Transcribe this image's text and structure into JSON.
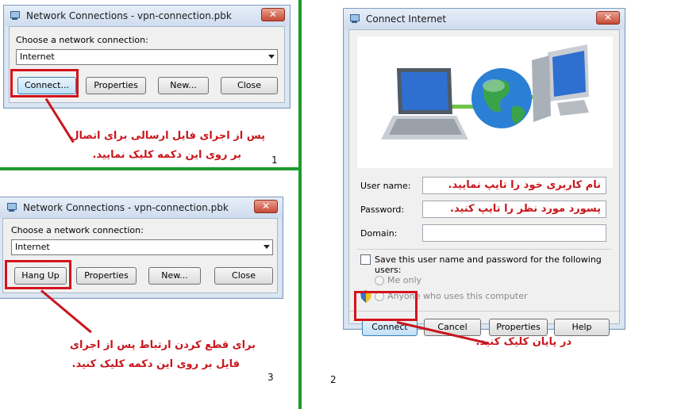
{
  "dialog1": {
    "title": "Network Connections - vpn-connection.pbk",
    "choose_label": "Choose a network connection:",
    "selected_connection": "Internet",
    "buttons": [
      "Connect...",
      "Properties",
      "New...",
      "Close"
    ],
    "annotation_line1": "پس از اجرای فایل ارسالی برای اتصال",
    "annotation_line2": "بر روی این دکمه کلیک نمایید.",
    "step_number": "1"
  },
  "dialog3": {
    "title": "Network Connections - vpn-connection.pbk",
    "choose_label": "Choose a network connection:",
    "selected_connection": "Internet",
    "buttons": [
      "Hang Up",
      "Properties",
      "New...",
      "Close"
    ],
    "annotation_line1": "برای قطع کردن ارتباط پس از اجرای",
    "annotation_line2": "فایل بر روی این دکمه کلیک کنید.",
    "step_number": "3"
  },
  "dialog2": {
    "title": "Connect Internet",
    "username_label": "User name:",
    "username_value": "نام کاربری خود  را تایپ نمایید.",
    "password_label": "Password:",
    "password_value": "پسورد مورد نظر را تایپ کنید.",
    "domain_label": "Domain:",
    "save_label": "Save this user name and password for the following users:",
    "me_only": "Me only",
    "anyone": "Anyone who uses this computer",
    "buttons": [
      "Connect",
      "Cancel",
      "Properties",
      "Help"
    ],
    "annotation": "در پایان کلیک کنید.",
    "step_number": "2"
  },
  "colors": {
    "annotation_red": "#c8161d",
    "separator_green": "#1e9b2e"
  }
}
